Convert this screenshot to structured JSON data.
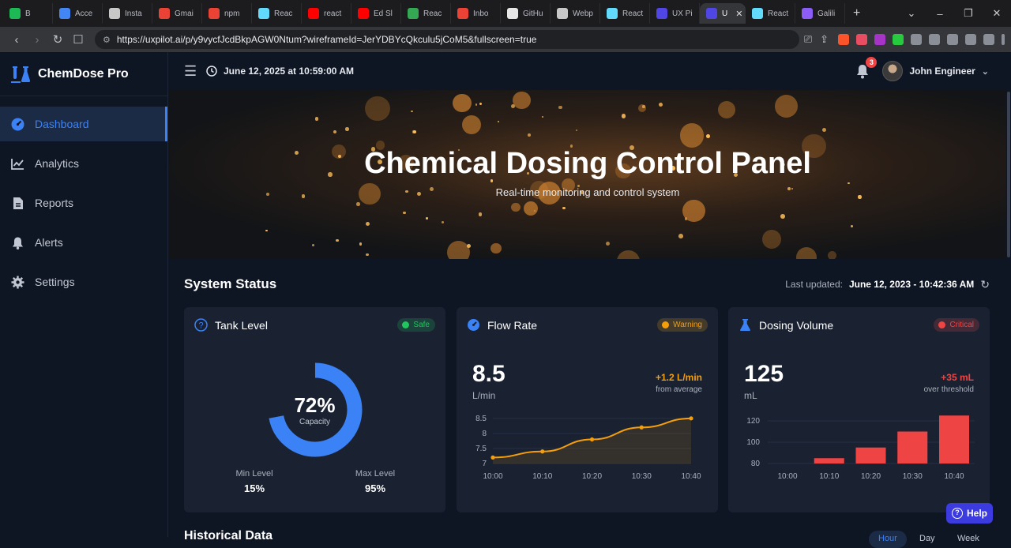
{
  "browser": {
    "tabs": [
      {
        "label": "B",
        "color": "#1db954"
      },
      {
        "label": "Acce",
        "color": "#4285f4"
      },
      {
        "label": "Insta",
        "color": "#c8c8c8"
      },
      {
        "label": "Gmai",
        "color": "#ea4335"
      },
      {
        "label": "npm",
        "color": "#ea4335"
      },
      {
        "label": "Reac",
        "color": "#61dafb"
      },
      {
        "label": "react",
        "color": "#ff0000"
      },
      {
        "label": "Ed Sl",
        "color": "#ff0000"
      },
      {
        "label": "Reac",
        "color": "#34a853"
      },
      {
        "label": "Inbo",
        "color": "#ea4335"
      },
      {
        "label": "GitHu",
        "color": "#e6e6e6"
      },
      {
        "label": "Webp",
        "color": "#c8c8c8"
      },
      {
        "label": "React",
        "color": "#61dafb"
      },
      {
        "label": "UX Pi",
        "color": "#4f46e5"
      },
      {
        "label": "U",
        "color": "#4f46e5",
        "active": true
      },
      {
        "label": "React",
        "color": "#61dafb"
      },
      {
        "label": "Galili",
        "color": "#8b5cf6"
      }
    ],
    "url": "https://uxpilot.ai/p/y9vycfJcdBkpAGW0Ntum?wireframeId=JerYDBYcQkculu5jCoM5&fullscreen=true"
  },
  "app": {
    "brand": "ChemDose Pro",
    "nav": [
      {
        "label": "Dashboard",
        "icon": "dashboard-icon",
        "active": true
      },
      {
        "label": "Analytics",
        "icon": "analytics-icon"
      },
      {
        "label": "Reports",
        "icon": "reports-icon"
      },
      {
        "label": "Alerts",
        "icon": "bell-icon"
      },
      {
        "label": "Settings",
        "icon": "gear-icon"
      }
    ],
    "datetime": "June 12, 2025 at 10:59:00 AM",
    "notifications": "3",
    "user": "John Engineer",
    "hero": {
      "title": "Chemical Dosing Control Panel",
      "subtitle": "Real-time monitoring and control system"
    },
    "status": {
      "title": "System Status",
      "updated_label": "Last updated:",
      "updated_value": "June 12, 2023 - 10:42:36 AM"
    },
    "cards": {
      "tank": {
        "title": "Tank Level",
        "badge": "Safe",
        "badge_color": "#22c55e",
        "value": "72%",
        "caption": "Capacity",
        "level_fraction": 0.72,
        "min_label": "Min Level",
        "min_value": "15%",
        "max_label": "Max Level",
        "max_value": "95%"
      },
      "flow": {
        "title": "Flow Rate",
        "badge": "Warning",
        "badge_color": "#f59e0b",
        "value": "8.5",
        "unit": "L/min",
        "delta": "+1.2 L/min",
        "delta_note": "from average"
      },
      "dosing": {
        "title": "Dosing Volume",
        "badge": "Critical",
        "badge_color": "#ef4444",
        "value": "125",
        "unit": "mL",
        "delta": "+35 mL",
        "delta_note": "over threshold"
      }
    },
    "help": "Help",
    "historical": {
      "title": "Historical Data",
      "ranges": [
        "Hour",
        "Day",
        "Week"
      ]
    }
  },
  "chart_data": [
    {
      "type": "line",
      "x": [
        "10:00",
        "10:10",
        "10:20",
        "10:30",
        "10:40"
      ],
      "series": [
        {
          "values": [
            7.2,
            7.4,
            7.8,
            8.2,
            8.5
          ]
        }
      ],
      "yticks": [
        7.0,
        7.5,
        8.0,
        8.5
      ],
      "ylim": [
        7.0,
        8.6
      ],
      "color": "#f59e0b"
    },
    {
      "type": "bar",
      "categories": [
        "10:00",
        "10:10",
        "10:20",
        "10:30",
        "10:40"
      ],
      "values": [
        0,
        85,
        95,
        110,
        125
      ],
      "yticks": [
        80,
        100,
        120
      ],
      "ylim": [
        80,
        125
      ],
      "color": "#ef4444"
    }
  ]
}
